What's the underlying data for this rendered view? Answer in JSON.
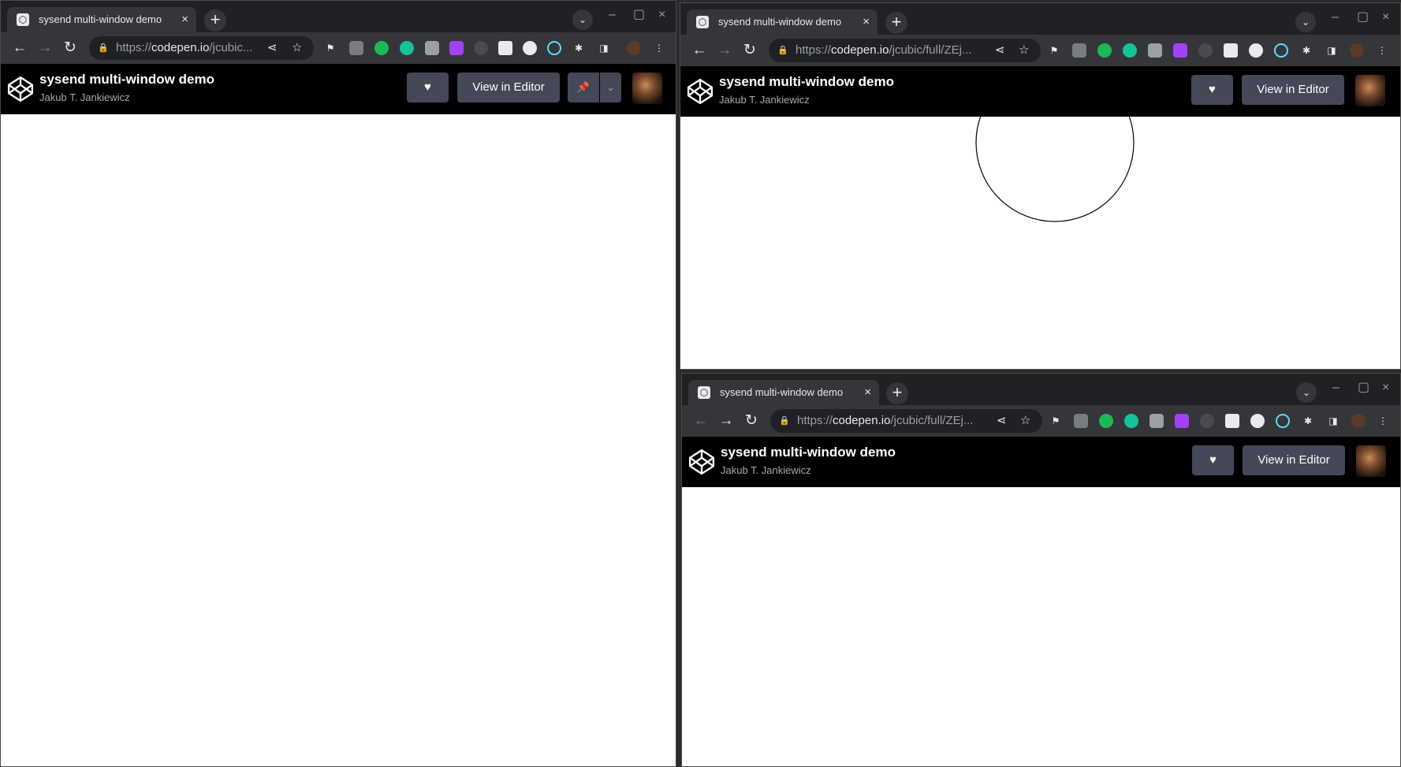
{
  "windows": [
    {
      "tab_title": "sysend multi-window demo",
      "url_prefix": "https://",
      "url_host": "codepen.io",
      "url_path": "/jcubic...",
      "page_title": "sysend multi-window demo",
      "page_author": "Jakub T. Jankiewicz",
      "view_button_label": "View in Editor"
    },
    {
      "tab_title": "sysend multi-window demo",
      "url_prefix": "https://",
      "url_host": "codepen.io",
      "url_path": "/jcubic/full/ZEj...",
      "page_title": "sysend multi-window demo",
      "page_author": "Jakub T. Jankiewicz",
      "view_button_label": "View in Editor"
    },
    {
      "tab_title": "sysend multi-window demo",
      "url_prefix": "https://",
      "url_host": "codepen.io",
      "url_path": "/jcubic/full/ZEj...",
      "page_title": "sysend multi-window demo",
      "page_author": "Jakub T. Jankiewicz",
      "view_button_label": "View in Editor"
    }
  ],
  "icons": {
    "close": "×",
    "new_tab": "+",
    "tab_search": "⌄",
    "minimize": "–",
    "maximize": "▢",
    "back": "←",
    "forward": "→",
    "reload": "↻",
    "lock": "🔒",
    "share": "⋖",
    "star": "☆",
    "flag": "⚑",
    "menu": "⋮",
    "heart": "♥",
    "pin": "📌",
    "chevron": "⌄",
    "puzzle": "✱",
    "sidepanel": "◨"
  },
  "colors": {
    "accent_button": "#444857",
    "header_bg": "#000000",
    "chrome_toolbar": "#35363a",
    "chrome_tabstrip": "#202124"
  }
}
